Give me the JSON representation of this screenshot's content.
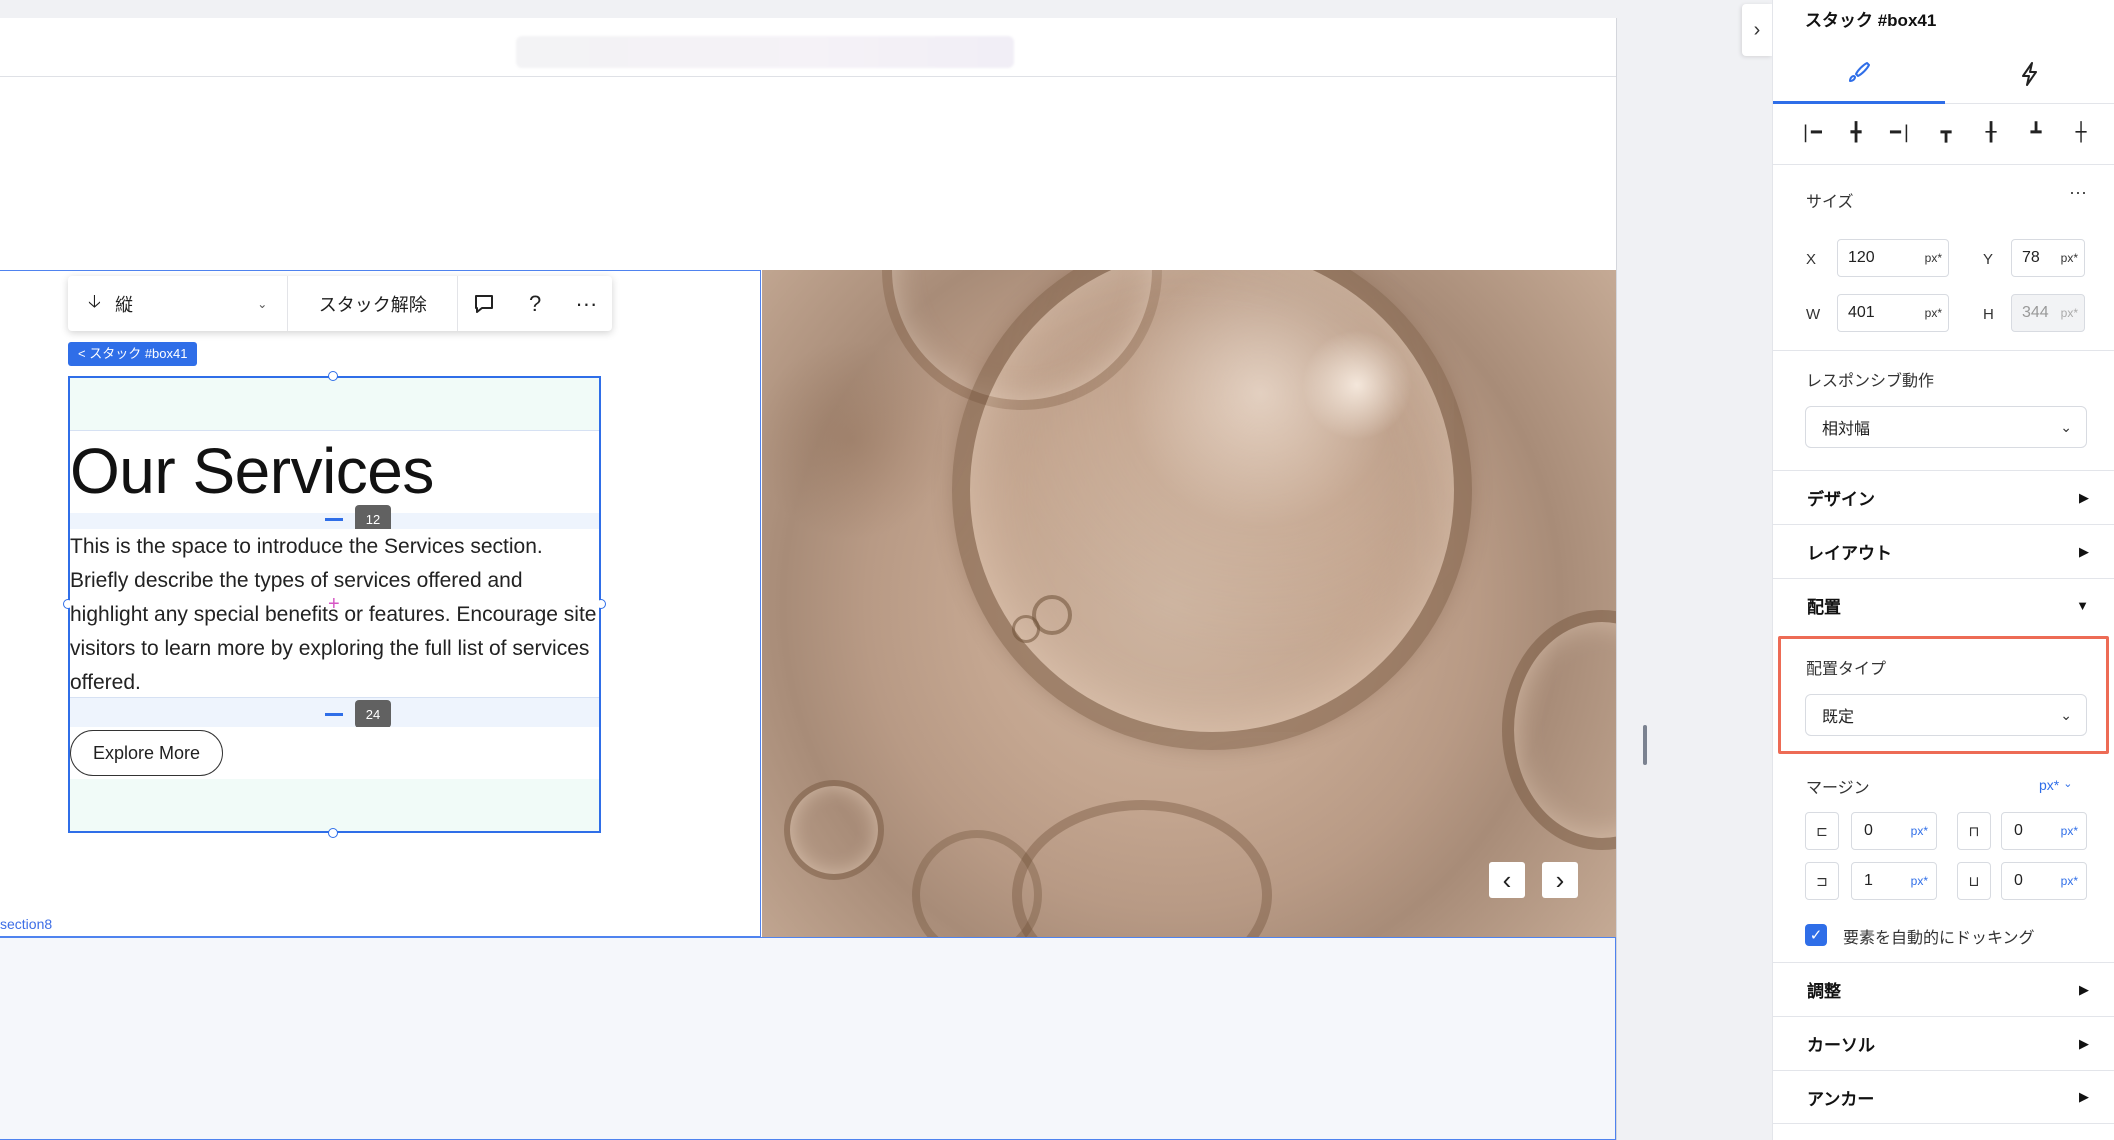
{
  "canvas": {
    "section_label": "section8",
    "stack_tag": "< スタック #box41",
    "toolbar": {
      "direction_label": "縦",
      "unstack_label": "スタック解除",
      "help_label": "?",
      "more_label": "···"
    },
    "title": "Our Services",
    "paragraph": "This is the space to introduce the Services section. Briefly describe the types of services offered and highlight any special benefits or features. Encourage site visitors to learn more by exploring the full list of services offered.",
    "button_label": "Explore More",
    "gap_top": "12",
    "gap_bottom": "24",
    "carousel_prev": "‹",
    "carousel_next": "›"
  },
  "panel": {
    "title": "スタック #box41",
    "size": {
      "label": "サイズ",
      "more": "···",
      "x_label": "X",
      "x_value": "120",
      "x_unit": "px*",
      "y_label": "Y",
      "y_value": "78",
      "y_unit": "px*",
      "w_label": "W",
      "w_value": "401",
      "w_unit": "px*",
      "h_label": "H",
      "h_value": "344",
      "h_unit": "px*"
    },
    "responsive": {
      "label": "レスポンシブ動作",
      "value": "相対幅"
    },
    "sections": {
      "design": "デザイン",
      "layout": "レイアウト",
      "placement": "配置",
      "adjust": "調整",
      "cursor": "カーソル",
      "anchor": "アンカー"
    },
    "placement_type": {
      "label": "配置タイプ",
      "value": "既定"
    },
    "margin": {
      "label": "マージン",
      "unit_select": "px*",
      "left": "0",
      "top": "0",
      "right": "1",
      "bottom": "0",
      "unit": "px*"
    },
    "auto_dock": {
      "label": "要素を自動的にドッキング",
      "checked": true
    }
  },
  "colors": {
    "accent": "#2f6ee8",
    "highlight": "#ed6b55"
  }
}
